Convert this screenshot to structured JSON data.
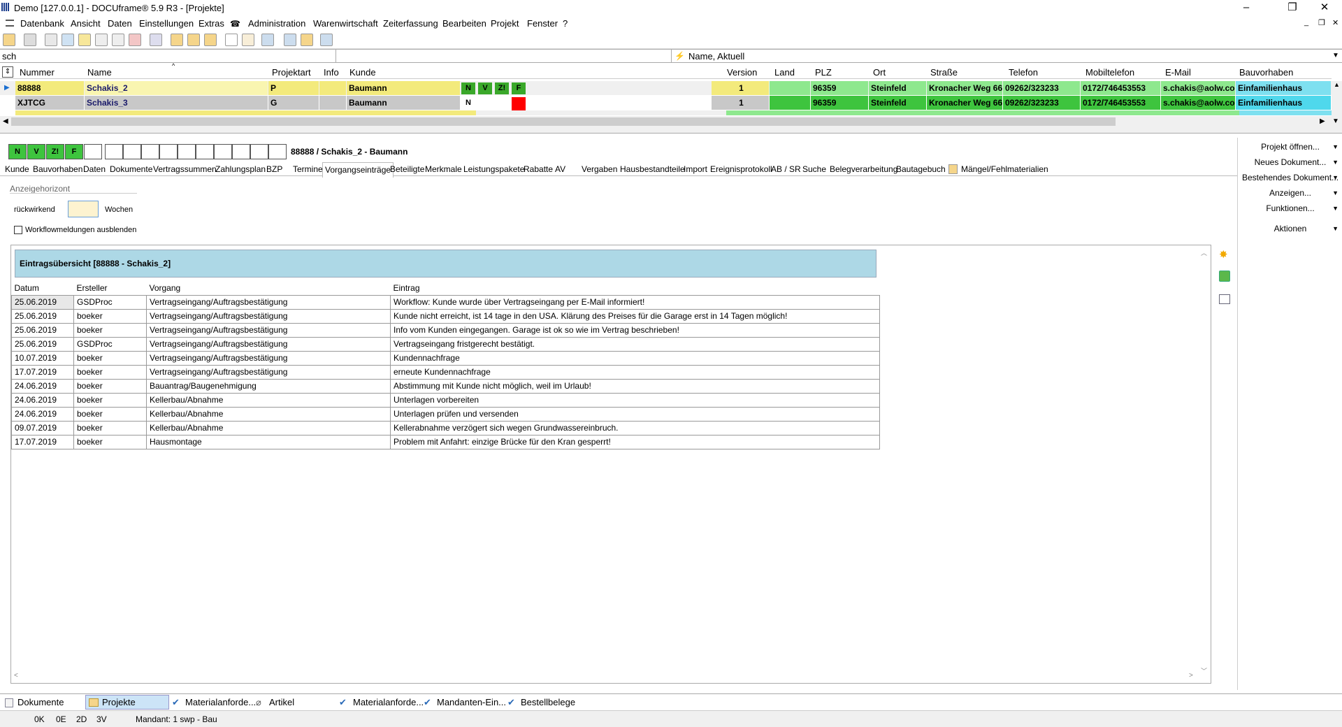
{
  "window": {
    "title": "Demo [127.0.0.1] - DOCUframe® 5.9 R3 - [Projekte]"
  },
  "menu": [
    "Datenbank",
    "Ansicht",
    "Daten",
    "Einstellungen",
    "Extras",
    "Administration",
    "Warenwirtschaft",
    "Zeiterfassung",
    "Bearbeiten",
    "Projekt",
    "Fenster",
    "?"
  ],
  "search": {
    "value": "sch",
    "sort": "Name, Aktuell"
  },
  "grid": {
    "headers": [
      "Nummer",
      "Name",
      "Projektart",
      "Info",
      "Kunde",
      "Version",
      "Land",
      "PLZ",
      "Ort",
      "Straße",
      "Telefon",
      "Mobiltelefon",
      "E-Mail",
      "Bauvorhaben"
    ],
    "rows": [
      {
        "nummer": "88888",
        "name": "Schakis_2",
        "art": "P",
        "kunde": "Baumann",
        "flags": [
          "N",
          "V",
          "Z!",
          "F"
        ],
        "version": "1",
        "plz": "96359",
        "ort": "Steinfeld",
        "strasse": "Kronacher Weg 66",
        "telefon": "09262/323233",
        "mobil": "0172/746453553",
        "email": "s.chakis@aolw.com",
        "bauvorhaben": "Einfamilienhaus"
      },
      {
        "nummer": "XJTCG",
        "name": "Schakis_3",
        "art": "G",
        "kunde": "Baumann",
        "flags": [
          "N"
        ],
        "version": "1",
        "plz": "96359",
        "ort": "Steinfeld",
        "strasse": "Kronacher Weg 66",
        "telefon": "09262/323233",
        "mobil": "0172/746453553",
        "email": "s.chakis@aolw.com",
        "bauvorhaben": "Einfamilienhaus"
      }
    ]
  },
  "detail": {
    "title": "88888 / Schakis_2 - Baumann",
    "status": [
      "N",
      "V",
      "Z!",
      "F"
    ],
    "tabs": [
      "Kunde",
      "Bauvorhaben",
      "Daten",
      "Dokumente",
      "Vertragssummen",
      "Zahlungsplan",
      "BZP",
      "Termine",
      "Vorgangseinträge",
      "Beteiligte",
      "Merkmale",
      "Leistungspakete",
      "Rabatte",
      "AV",
      "Vergaben",
      "Hausbestandteile",
      "Import",
      "Ereignisprotokoll",
      "AB / SR",
      "Suche",
      "Belegverarbeitung",
      "Bautagebuch",
      "Mängel/Fehlmaterialien"
    ],
    "horizon_label": "Anzeigehorizont",
    "retro_label": "rückwirkend",
    "weeks_label": "Wochen",
    "workflow_label": "Workflowmeldungen ausblenden",
    "overview_title": "Eintragsübersicht [88888 - Schakis_2]",
    "columns": [
      "Datum",
      "Ersteller",
      "Vorgang",
      "Eintrag"
    ],
    "entries": [
      [
        "25.06.2019",
        "GSDProc",
        "Vertragseingang/Auftragsbestätigung",
        "Workflow: Kunde wurde über Vertragseingang per E-Mail informiert!"
      ],
      [
        "25.06.2019",
        "boeker",
        "Vertragseingang/Auftragsbestätigung",
        "Kunde nicht erreicht, ist 14 tage in den USA. Klärung des Preises für die Garage erst in 14 Tagen möglich!"
      ],
      [
        "25.06.2019",
        "boeker",
        "Vertragseingang/Auftragsbestätigung",
        "Info vom Kunden eingegangen. Garage ist ok so wie im Vertrag beschrieben!"
      ],
      [
        "25.06.2019",
        "GSDProc",
        "Vertragseingang/Auftragsbestätigung",
        "Vertragseingang fristgerecht bestätigt."
      ],
      [
        "10.07.2019",
        "boeker",
        "Vertragseingang/Auftragsbestätigung",
        "Kundennachfrage"
      ],
      [
        "17.07.2019",
        "boeker",
        "Vertragseingang/Auftragsbestätigung",
        "erneute Kundennachfrage"
      ],
      [
        "24.06.2019",
        "boeker",
        "Bauantrag/Baugenehmigung",
        "Abstimmung mit Kunde nicht möglich, weil im Urlaub!"
      ],
      [
        "24.06.2019",
        "boeker",
        "Kellerbau/Abnahme",
        "Unterlagen vorbereiten"
      ],
      [
        "24.06.2019",
        "boeker",
        "Kellerbau/Abnahme",
        "Unterlagen prüfen und versenden"
      ],
      [
        "09.07.2019",
        "boeker",
        "Kellerbau/Abnahme",
        "Kellerabnahme verzögert sich wegen Grundwassereinbruch."
      ],
      [
        "17.07.2019",
        "boeker",
        "Hausmontage",
        "Problem mit Anfahrt: einzige Brücke für den Kran gesperrt!"
      ]
    ]
  },
  "rightpanel": [
    "Projekt öffnen...",
    "Neues Dokument...",
    "Bestehendes Dokument...",
    "Anzeigen...",
    "Funktionen...",
    "Aktionen"
  ],
  "bottomtabs": [
    "Dokumente",
    "Projekte",
    "Materialanforde...",
    "Artikel",
    "Materialanforde...",
    "Mandanten-Ein...",
    "Bestellbelege"
  ],
  "status": [
    "0K",
    "0E",
    "2D",
    "3V",
    "Mandant: 1 swp - Bau"
  ]
}
